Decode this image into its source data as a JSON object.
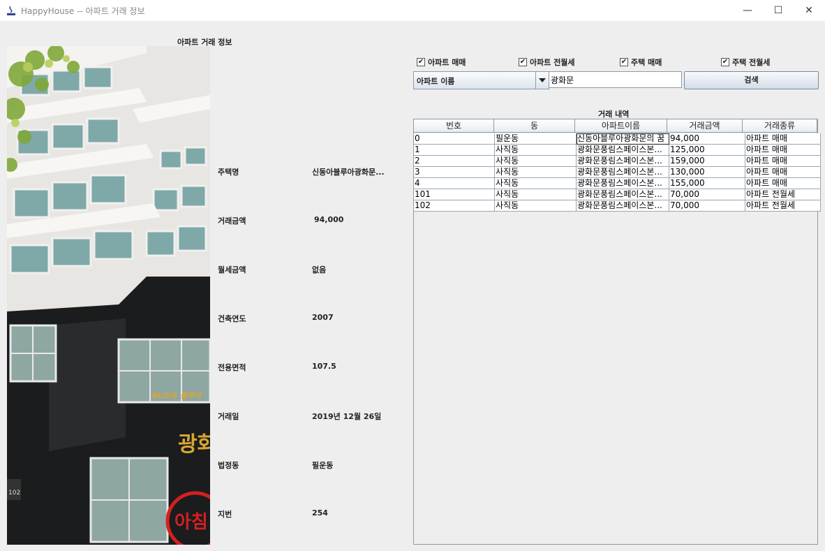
{
  "window": {
    "title": "HappyHouse -- 아파트 거래 정보",
    "minimize": "—",
    "maximize": "☐",
    "close": "✕"
  },
  "panel_title": "아파트 거래 정보",
  "photo": {
    "sign_brand": "BLOIS 블루아",
    "sign_name": "광화",
    "sign_red": "아침",
    "door_number": "102"
  },
  "details": [
    {
      "label": "주택명",
      "value": "신동아블루아광화문..."
    },
    {
      "label": "거래금액",
      "value": "94,000"
    },
    {
      "label": "월세금액",
      "value": "없음"
    },
    {
      "label": "건축연도",
      "value": "2007"
    },
    {
      "label": "전용면적",
      "value": "107.5"
    },
    {
      "label": "거래일",
      "value": "2019년 12월 26일"
    },
    {
      "label": "법정동",
      "value": "필운동"
    },
    {
      "label": "지번",
      "value": "254"
    }
  ],
  "filters": [
    {
      "label": "아파트 매매",
      "checked": true
    },
    {
      "label": "아파트 전월세",
      "checked": true
    },
    {
      "label": "주택 매매",
      "checked": true
    },
    {
      "label": "주택 전월세",
      "checked": true
    }
  ],
  "check_glyph": "✔",
  "search": {
    "type_selected": "아파트 이름",
    "query": "광화문",
    "button_label": "검색"
  },
  "table": {
    "title": "거래 내역",
    "columns": [
      "번호",
      "동",
      "아파트이름",
      "거래금액",
      "거래종류"
    ],
    "rows": [
      [
        "0",
        "필운동",
        "신동아블루아광화문의 꿈",
        "94,000",
        "아파트 매매"
      ],
      [
        "1",
        "사직동",
        "광화문풍림스페이스본...",
        "125,000",
        "아파트 매매"
      ],
      [
        "2",
        "사직동",
        "광화문풍림스페이스본...",
        "159,000",
        "아파트 매매"
      ],
      [
        "3",
        "사직동",
        "광화문풍림스페이스본...",
        "130,000",
        "아파트 매매"
      ],
      [
        "4",
        "사직동",
        "광화문풍림스페이스본...",
        "155,000",
        "아파트 매매"
      ],
      [
        "101",
        "사직동",
        "광화문풍림스페이스본...",
        "70,000",
        "아파트 전월세"
      ],
      [
        "102",
        "사직동",
        "광화문풍림스페이스본...",
        "70,000",
        "아파트 전월세"
      ]
    ]
  }
}
